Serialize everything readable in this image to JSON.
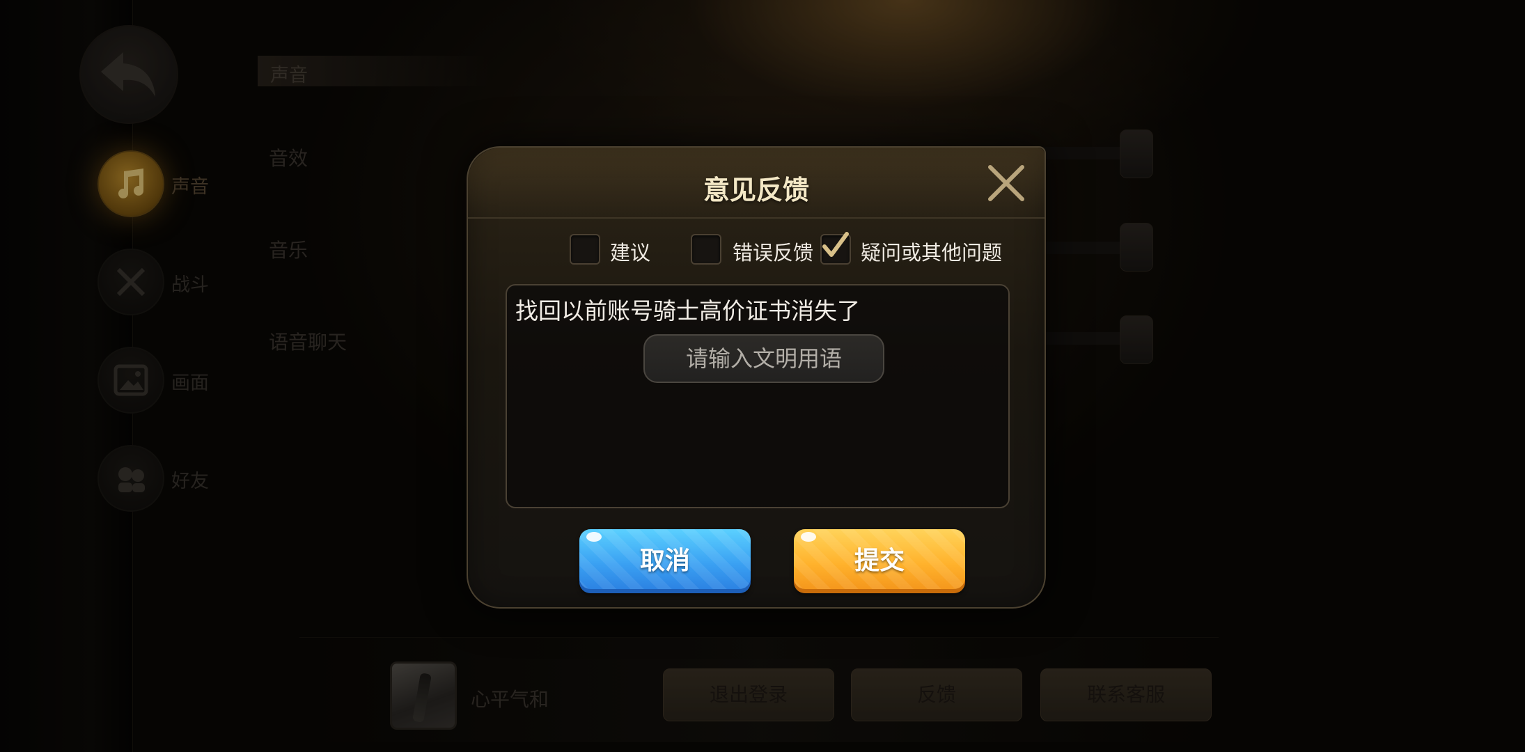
{
  "sidebar": {
    "items": [
      {
        "label": "声音",
        "icon": "music-note-icon",
        "active": true
      },
      {
        "label": "战斗",
        "icon": "crossed-swords-icon",
        "active": false
      },
      {
        "label": "画面",
        "icon": "image-icon",
        "active": false
      },
      {
        "label": "好友",
        "icon": "friends-icon",
        "active": false
      }
    ]
  },
  "settings": {
    "section_title": "声音",
    "rows": [
      {
        "label": "音效"
      },
      {
        "label": "音乐"
      },
      {
        "label": "语音聊天"
      }
    ]
  },
  "profile": {
    "nickname": "心平气和"
  },
  "bottom_buttons": {
    "logout": "退出登录",
    "feedback": "反馈",
    "support": "联系客服"
  },
  "dialog": {
    "title": "意见反馈",
    "categories": [
      {
        "label": "建议",
        "checked": false
      },
      {
        "label": "错误反馈",
        "checked": false
      },
      {
        "label": "疑问或其他问题",
        "checked": true
      }
    ],
    "input_value": "找回以前账号骑士高价证书消失了",
    "placeholder": "请输入文明用语",
    "cancel_label": "取消",
    "submit_label": "提交"
  },
  "colors": {
    "cancel_button": "#3aa0f2",
    "submit_button": "#ffb22c",
    "dialog_title": "#f4e8c6"
  }
}
